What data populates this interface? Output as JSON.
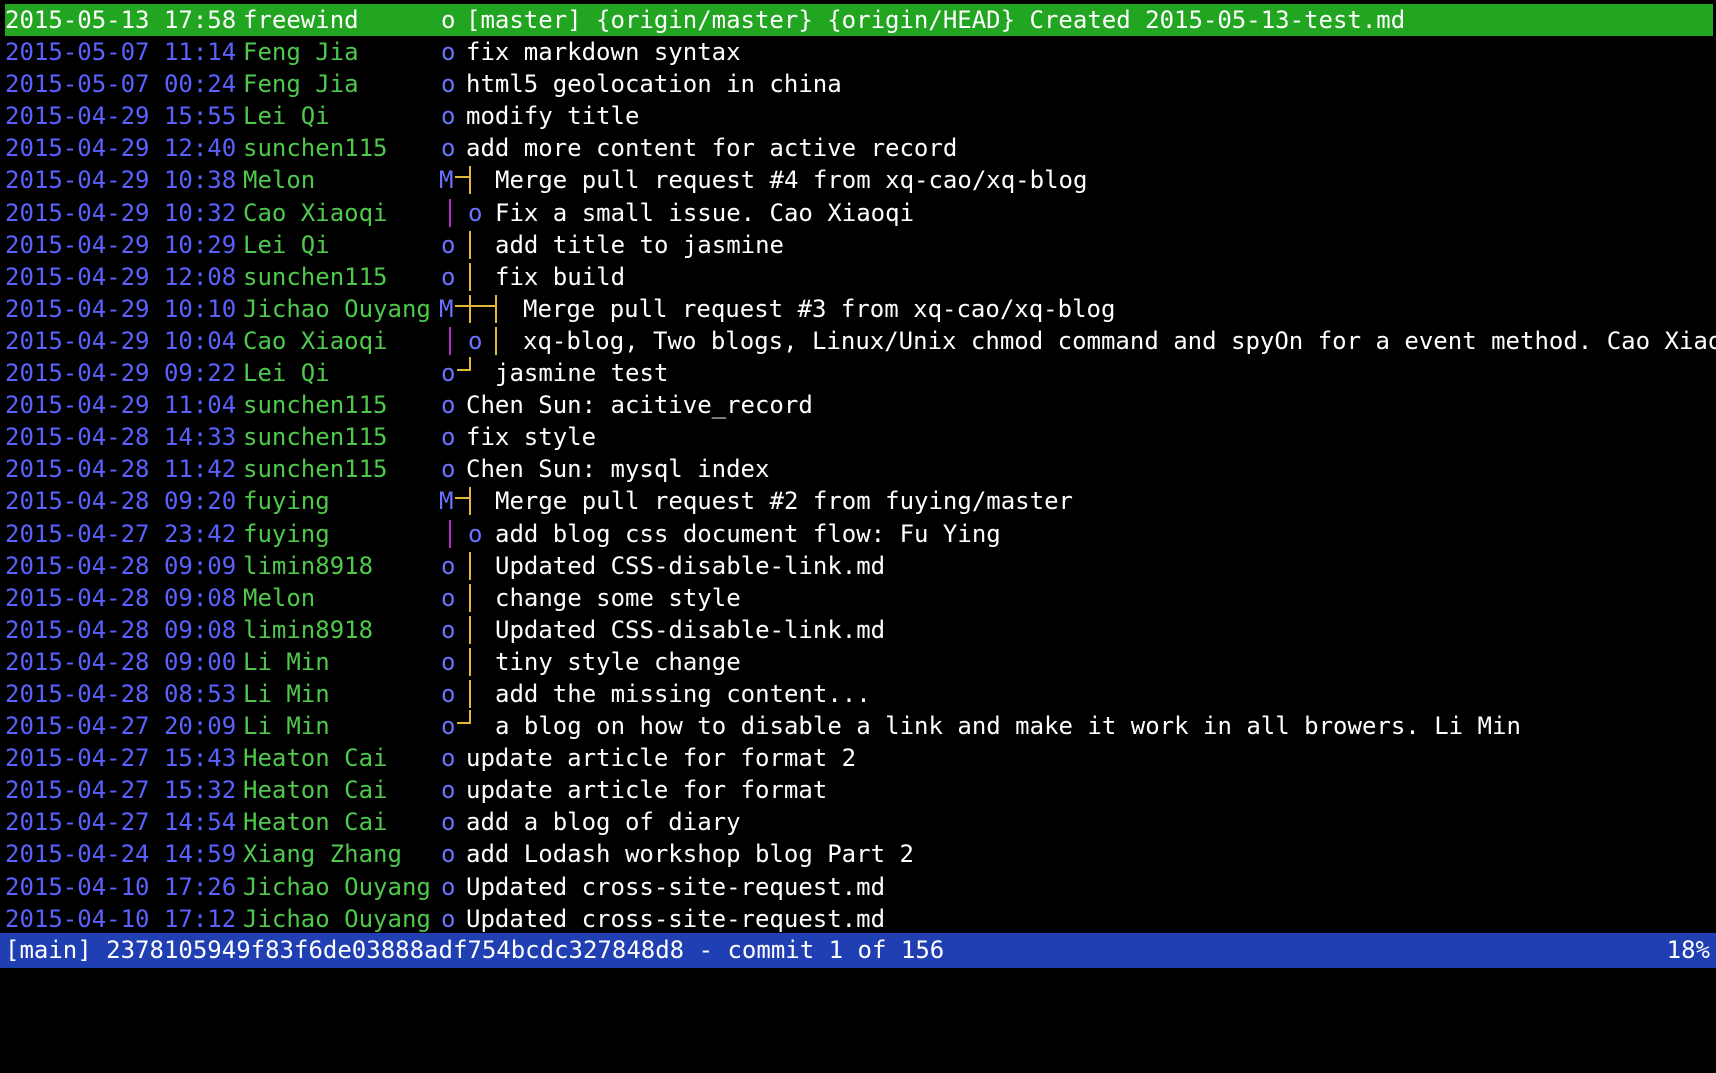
{
  "window": {
    "view": "main",
    "commit_hash": "2378105949f83f6de03888adf754bcdc327848d8",
    "position_label": "commit 1 of 156",
    "scroll_percent": "18%"
  },
  "colors": {
    "date": "#5a61ff",
    "author": "#4fc94b",
    "graph_primary": "#6a73ff",
    "graph_branch": "#b52fc4",
    "graph_branch2": "#e0b83a",
    "selection": "#22a621",
    "status_bar": "#1f3fb3"
  },
  "commits": [
    {
      "date": "2015-05-13 17:58",
      "author": "freewind",
      "graph": "o",
      "message": "[master] {origin/master} {origin/HEAD} Created 2015-05-13-test.md",
      "selected": true
    },
    {
      "date": "2015-05-07 11:14",
      "author": "Feng Jia",
      "graph": "o",
      "message": "fix markdown syntax"
    },
    {
      "date": "2015-05-07 00:24",
      "author": "Feng Jia",
      "graph": "o",
      "message": "html5 geolocation in china"
    },
    {
      "date": "2015-04-29 15:55",
      "author": "Lei Qi",
      "graph": "o",
      "message": "modify title"
    },
    {
      "date": "2015-04-29 12:40",
      "author": "sunchen115",
      "graph": "o",
      "message": "add more content for active record"
    },
    {
      "date": "2015-04-29 10:38",
      "author": "Melon",
      "graph": "M",
      "message": "Merge pull request #4 from xq-cao/xq-blog"
    },
    {
      "date": "2015-04-29 10:32",
      "author": "Cao Xiaoqi",
      "graph": "|o",
      "message": "Fix a small issue. Cao Xiaoqi"
    },
    {
      "date": "2015-04-29 10:29",
      "author": "Lei Qi",
      "graph": "o|",
      "message": "add title to jasmine"
    },
    {
      "date": "2015-04-29 12:08",
      "author": "sunchen115",
      "graph": "o|",
      "message": "fix build"
    },
    {
      "date": "2015-04-29 10:10",
      "author": "Jichao Ouyang",
      "graph": "M2",
      "message": "Merge pull request #3 from xq-cao/xq-blog"
    },
    {
      "date": "2015-04-29 10:04",
      "author": "Cao Xiaoqi",
      "graph": "|o|",
      "message": "xq-blog, Two blogs, Linux/Unix chmod command and spyOn for a event method. Cao Xiaoqi"
    },
    {
      "date": "2015-04-29 09:22",
      "author": "Lei Qi",
      "graph": "o-",
      "message": "jasmine test"
    },
    {
      "date": "2015-04-29 11:04",
      "author": "sunchen115",
      "graph": "o",
      "message": "Chen Sun: acitive_record"
    },
    {
      "date": "2015-04-28 14:33",
      "author": "sunchen115",
      "graph": "o",
      "message": "fix style"
    },
    {
      "date": "2015-04-28 11:42",
      "author": "sunchen115",
      "graph": "o",
      "message": "Chen Sun: mysql index"
    },
    {
      "date": "2015-04-28 09:20",
      "author": "fuying",
      "graph": "M",
      "message": "Merge pull request #2 from fuying/master"
    },
    {
      "date": "2015-04-27 23:42",
      "author": "fuying",
      "graph": "|o",
      "message": "add blog css document flow: Fu Ying"
    },
    {
      "date": "2015-04-28 09:09",
      "author": "limin8918",
      "graph": "o|",
      "message": "Updated CSS-disable-link.md"
    },
    {
      "date": "2015-04-28 09:08",
      "author": "Melon",
      "graph": "o|",
      "message": "change some style"
    },
    {
      "date": "2015-04-28 09:08",
      "author": "limin8918",
      "graph": "o|",
      "message": "Updated CSS-disable-link.md"
    },
    {
      "date": "2015-04-28 09:00",
      "author": "Li Min",
      "graph": "o|",
      "message": "tiny style change"
    },
    {
      "date": "2015-04-28 08:53",
      "author": "Li Min",
      "graph": "o|",
      "message": "add the missing content..."
    },
    {
      "date": "2015-04-27 20:09",
      "author": "Li Min",
      "graph": "o-",
      "message": "a blog on how to disable a link and make it work in all browers. Li Min"
    },
    {
      "date": "2015-04-27 15:43",
      "author": "Heaton Cai",
      "graph": "o",
      "message": "update article for format 2"
    },
    {
      "date": "2015-04-27 15:32",
      "author": "Heaton Cai",
      "graph": "o",
      "message": "update article for format"
    },
    {
      "date": "2015-04-27 14:54",
      "author": "Heaton Cai",
      "graph": "o",
      "message": "add a blog of diary"
    },
    {
      "date": "2015-04-24 14:59",
      "author": "Xiang Zhang",
      "graph": "o",
      "message": "add Lodash workshop blog Part 2"
    },
    {
      "date": "2015-04-10 17:26",
      "author": "Jichao Ouyang",
      "graph": "o",
      "message": "Updated cross-site-request.md"
    },
    {
      "date": "2015-04-10 17:12",
      "author": "Jichao Ouyang",
      "graph": "o",
      "message": "Updated cross-site-request.md"
    }
  ]
}
